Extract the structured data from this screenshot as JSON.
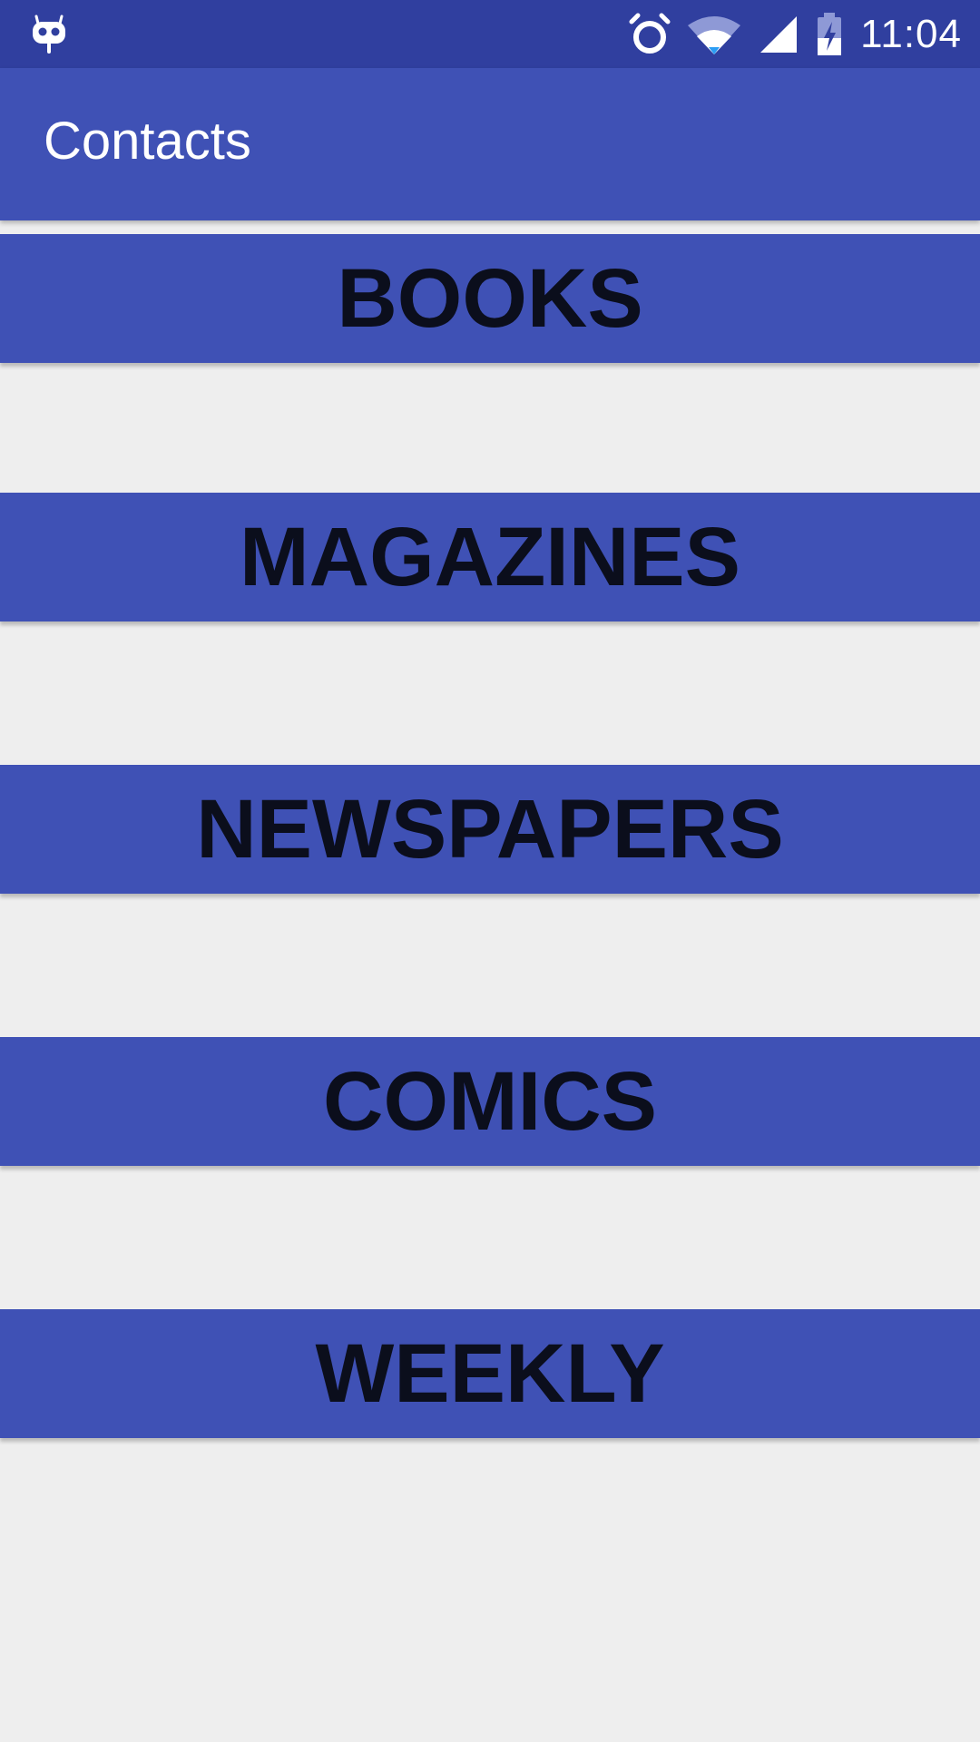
{
  "status_bar": {
    "time": "11:04",
    "icons": [
      "cyanogenmod-icon",
      "alarm-icon",
      "wifi-icon",
      "cell-signal-icon",
      "battery-charging-icon"
    ],
    "background_color": "#303f9f"
  },
  "app_bar": {
    "title": "Contacts",
    "background_color": "#3f51b5"
  },
  "categories": [
    {
      "label": "BOOKS"
    },
    {
      "label": "MAGAZINES"
    },
    {
      "label": "NEWSPAPERS"
    },
    {
      "label": "COMICS"
    },
    {
      "label": "WEEKLY"
    }
  ],
  "colors": {
    "button_background": "#3f51b5",
    "button_text": "#0b0e1c",
    "page_background": "#eeeeee"
  }
}
